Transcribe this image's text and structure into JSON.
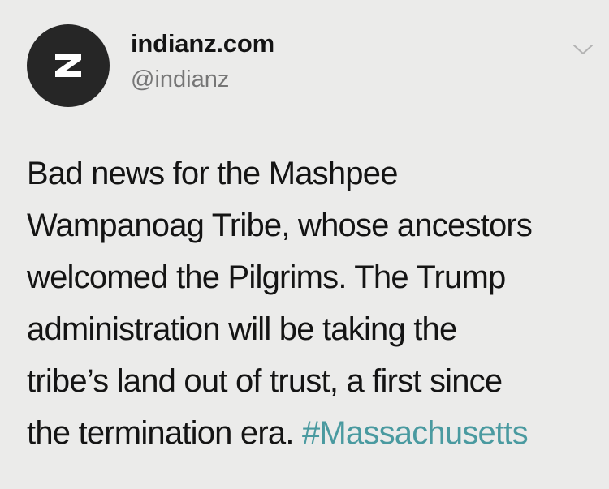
{
  "tweet": {
    "author": {
      "display_name": "indianz.com",
      "handle": "@indianz",
      "avatar_letter": "z",
      "avatar_icon": "indianz-z-logo-icon"
    },
    "menu_icon": "chevron-down-icon",
    "body_lines": [
      "Bad news for the Mashpee",
      "Wampanoag Tribe, whose ancestors",
      "welcomed the Pilgrims. The Trump",
      "administration will be taking the",
      "tribe’s land out of trust, a first since",
      "the termination era. "
    ],
    "hashtag": "#Massachusetts"
  },
  "colors": {
    "background": "#ebebea",
    "text": "#141414",
    "secondary_text": "#767676",
    "hashtag": "#4a9aa0",
    "avatar_bg": "#262626"
  }
}
